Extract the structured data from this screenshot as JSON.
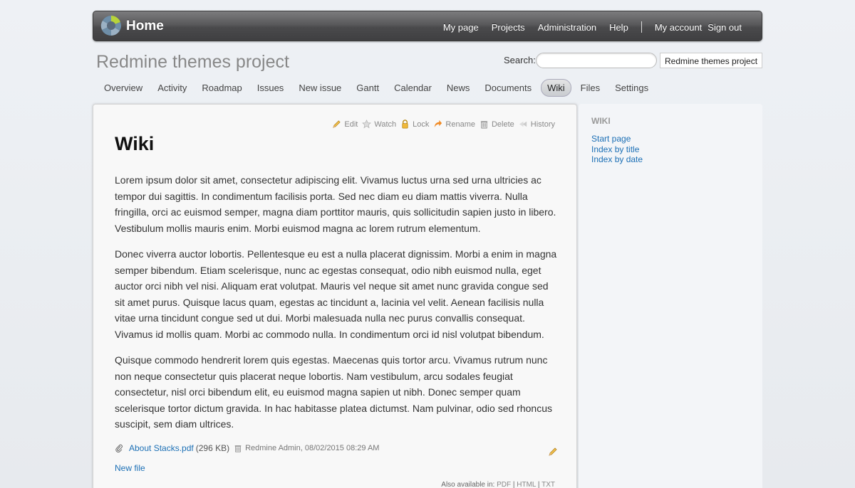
{
  "topbar": {
    "home": "Home",
    "links": [
      "My page",
      "Projects",
      "Administration",
      "Help"
    ],
    "account": "My account",
    "signout": "Sign out"
  },
  "header": {
    "project_title": "Redmine themes project",
    "search_label": "Search:",
    "search_value": "",
    "project_jump": "Redmine themes project"
  },
  "tabs": [
    "Overview",
    "Activity",
    "Roadmap",
    "Issues",
    "New issue",
    "Gantt",
    "Calendar",
    "News",
    "Documents",
    "Wiki",
    "Files",
    "Settings"
  ],
  "selected_tab": "Wiki",
  "contextual": {
    "edit": "Edit",
    "watch": "Watch",
    "lock": "Lock",
    "rename": "Rename",
    "delete": "Delete",
    "history": "History"
  },
  "wiki": {
    "title": "Wiki",
    "paragraphs": [
      "Lorem ipsum dolor sit amet, consectetur adipiscing elit. Vivamus luctus urna sed urna ultricies ac tempor dui sagittis. In condimentum facilisis porta. Sed nec diam eu diam mattis viverra. Nulla fringilla, orci ac euismod semper, magna diam porttitor mauris, quis sollicitudin sapien justo in libero. Vestibulum mollis mauris enim. Morbi euismod magna ac lorem rutrum elementum.",
      "Donec viverra auctor lobortis. Pellentesque eu est a nulla placerat dignissim. Morbi a enim in magna semper bibendum. Etiam scelerisque, nunc ac egestas consequat, odio nibh euismod nulla, eget auctor orci nibh vel nisi. Aliquam erat volutpat. Mauris vel neque sit amet nunc gravida congue sed sit amet purus. Quisque lacus quam, egestas ac tincidunt a, lacinia vel velit. Aenean facilisis nulla vitae urna tincidunt congue sed ut dui. Morbi malesuada nulla nec purus convallis consequat. Vivamus id mollis quam. Morbi ac commodo nulla. In condimentum orci id nisl volutpat bibendum.",
      "Quisque commodo hendrerit lorem quis egestas. Maecenas quis tortor arcu. Vivamus rutrum nunc non neque consectetur quis placerat neque lobortis. Nam vestibulum, arcu sodales feugiat consectetur, nisl orci bibendum elit, eu euismod magna sapien ut nibh. Donec semper quam scelerisque tortor dictum gravida. In hac habitasse platea dictumst. Nam pulvinar, odio sed rhoncus suscipit, sem diam ultrices."
    ]
  },
  "attachment": {
    "filename": "About Stacks.pdf",
    "size": "(296 KB)",
    "author_date": "Redmine Admin, 08/02/2015 08:29 AM"
  },
  "new_file": "New file",
  "also_available": {
    "label": "Also available in:",
    "formats": [
      "PDF",
      "HTML",
      "TXT"
    ]
  },
  "sidebar": {
    "heading": "WIKI",
    "links": [
      "Start page",
      "Index by title",
      "Index by date"
    ]
  },
  "colors": {
    "link": "#1b6fb5",
    "topbar": "#4a4a4c"
  }
}
